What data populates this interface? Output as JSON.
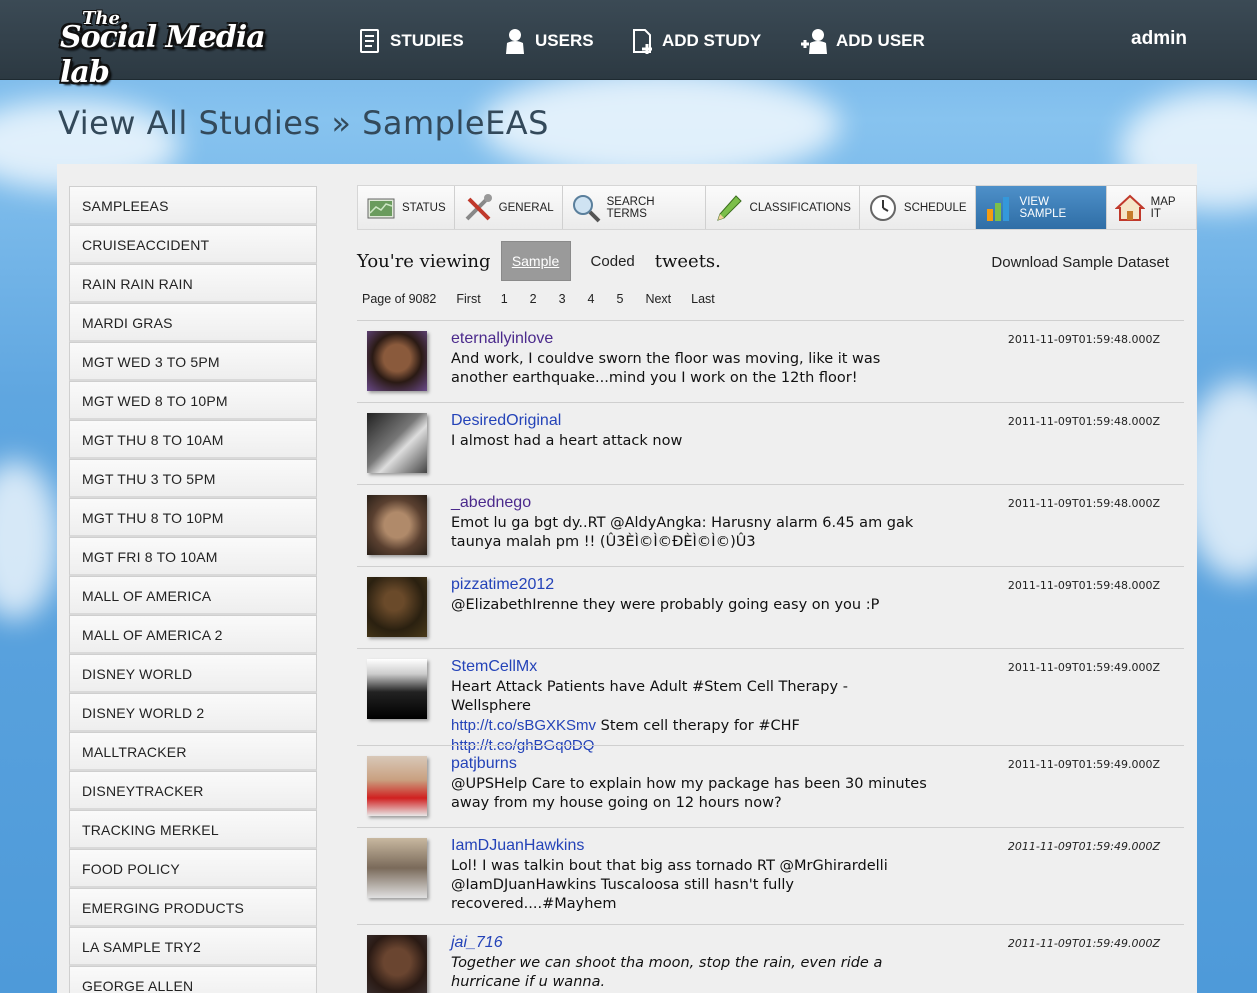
{
  "logo": {
    "small": "The",
    "big": "Social Media lab"
  },
  "nav": [
    {
      "label": "STUDIES",
      "icon": "document-icon"
    },
    {
      "label": "USERS",
      "icon": "user-icon"
    },
    {
      "label": "ADD STUDY",
      "icon": "add-document-icon"
    },
    {
      "label": "ADD USER",
      "icon": "add-user-icon"
    }
  ],
  "user": "admin",
  "breadcrumb": "View All Studies » SampleEAS",
  "sidebar": [
    "SAMPLEEAS",
    "CRUISEACCIDENT",
    "RAIN RAIN RAIN",
    "MARDI GRAS",
    "MGT WED 3 TO 5PM",
    "MGT WED 8 TO 10PM",
    "MGT THU 8 TO 10AM",
    "MGT THU 3 TO 5PM",
    "MGT THU 8 TO 10PM",
    "MGT FRI 8 TO 10AM",
    "MALL OF AMERICA",
    "MALL OF AMERICA 2",
    "DISNEY WORLD",
    "DISNEY WORLD 2",
    "MALLTRACKER",
    "DISNEYTRACKER",
    "TRACKING MERKEL",
    "FOOD POLICY",
    "EMERGING PRODUCTS",
    "LA SAMPLE TRY2",
    "GEORGE ALLEN"
  ],
  "toolbar": [
    {
      "label": "STATUS",
      "icon": "chart-icon"
    },
    {
      "label": "GENERAL",
      "icon": "tools-icon"
    },
    {
      "label": "SEARCH TERMS",
      "icon": "magnifier-icon"
    },
    {
      "label": "CLASSIFICATIONS",
      "icon": "pencil-icon"
    },
    {
      "label": "SCHEDULE",
      "icon": "clock-icon"
    },
    {
      "label": "VIEW SAMPLE",
      "icon": "bar-chart-icon"
    },
    {
      "label": "MAP IT",
      "icon": "house-icon"
    }
  ],
  "viewing": {
    "prefix": "You're viewing",
    "sample": "Sample",
    "coded": "Coded",
    "suffix": "tweets."
  },
  "download": "Download Sample Dataset",
  "pager": {
    "page_of": "Page of 9082",
    "first": "First",
    "pages": [
      "1",
      "2",
      "3",
      "4",
      "5"
    ],
    "next": "Next",
    "last": "Last"
  },
  "tweets": [
    {
      "user": "eternallyinlove",
      "text": "And work, I couldve sworn the floor was moving, like it was another earthquake...mind you I work on the 12th floor!",
      "time": "2011-11-09T01:59:48.000Z"
    },
    {
      "user": "DesiredOriginal",
      "text": "I almost had a heart attack now",
      "time": "2011-11-09T01:59:48.000Z"
    },
    {
      "user": "_abednego",
      "text": "Emot lu ga bgt dy..RT @AldyAngka: Harusny alarm 6.45 am gak taunya malah pm !! (Û3ÈÌ©Ì©ÐÈÌ©Ì©)Û3",
      "time": "2011-11-09T01:59:48.000Z"
    },
    {
      "user": "pizzatime2012",
      "text": "@ElizabethIrenne they were probably going easy on you :P",
      "time": "2011-11-09T01:59:48.000Z"
    },
    {
      "user": "StemCellMx",
      "text": "Heart Attack Patients have Adult #Stem Cell Therapy - Wellsphere",
      "link1": "http://t.co/sBGXKSmv",
      "text2": " Stem cell therapy for #CHF",
      "link2": "http://t.co/ghBGq0DQ",
      "time": "2011-11-09T01:59:49.000Z"
    },
    {
      "user": "patjburns",
      "text": "@UPSHelp Care to explain how my package has been 30 minutes away from my house going on 12 hours now?",
      "time": "2011-11-09T01:59:49.000Z"
    },
    {
      "user": "IamDJuanHawkins",
      "text": "Lol! I was talkin bout that big ass tornado RT @MrGhirardelli @IamDJuanHawkins Tuscaloosa still hasn't fully recovered....#Mayhem",
      "time": "2011-11-09T01:59:49.000Z"
    },
    {
      "user": "jai_716",
      "text": "Together we can shoot tha moon, stop the rain, even ride a hurricane if u wanna.",
      "time": "2011-11-09T01:59:49.000Z"
    }
  ]
}
